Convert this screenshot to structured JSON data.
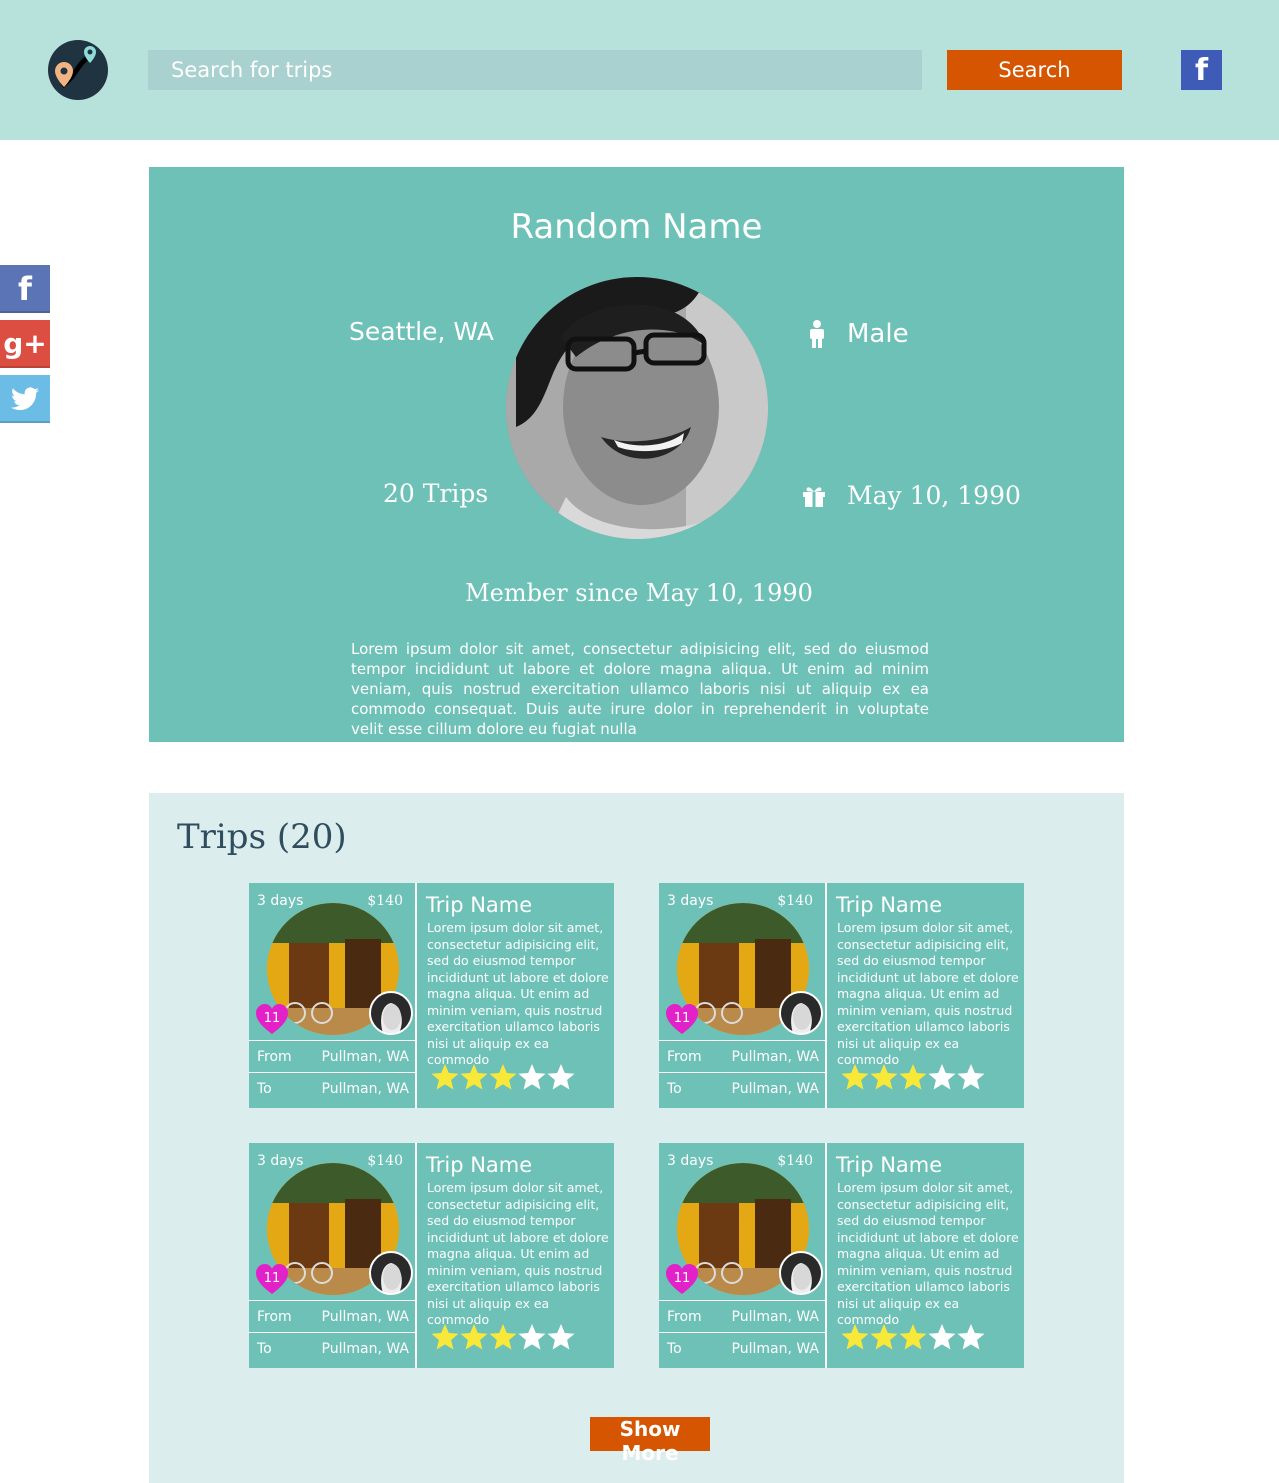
{
  "header": {
    "search_placeholder": "Search for trips",
    "search_label": "Search"
  },
  "share": [
    "facebook",
    "google-plus",
    "twitter"
  ],
  "profile": {
    "name": "Random Name",
    "location": "Seattle, WA",
    "trips": "20 Trips",
    "gender": "Male",
    "birthday": "May 10, 1990",
    "member_since": "Member since May 10, 1990",
    "bio": "Lorem ipsum dolor sit amet, consectetur adipisicing elit, sed do eiusmod tempor incididunt ut labore et dolore magna aliqua. Ut enim ad minim veniam, quis nostrud exercitation ullamco laboris nisi ut aliquip ex ea commodo consequat. Duis aute irure dolor in reprehenderit in voluptate velit esse cillum dolore eu fugiat nulla"
  },
  "trips_title": "Trips (20)",
  "trips": [
    {
      "days": "3 days",
      "price": "$140",
      "likes": "11",
      "from_label": "From",
      "from": "Pullman, WA",
      "to_label": "To",
      "to": "Pullman, WA",
      "name": "Trip Name",
      "desc": "Lorem ipsum dolor sit amet, consectetur adipisicing elit, sed do eiusmod tempor incididunt ut labore et dolore magna aliqua. Ut enim ad minim veniam, quis nostrud exercitation ullamco laboris nisi ut aliquip ex ea commodo",
      "rating": 3,
      "rating_max": 5
    },
    {
      "days": "3 days",
      "price": "$140",
      "likes": "11",
      "from_label": "From",
      "from": "Pullman, WA",
      "to_label": "To",
      "to": "Pullman, WA",
      "name": "Trip Name",
      "desc": "Lorem ipsum dolor sit amet, consectetur adipisicing elit, sed do eiusmod tempor incididunt ut labore et dolore magna aliqua. Ut enim ad minim veniam, quis nostrud exercitation ullamco laboris nisi ut aliquip ex ea commodo",
      "rating": 3,
      "rating_max": 5
    },
    {
      "days": "3 days",
      "price": "$140",
      "likes": "11",
      "from_label": "From",
      "from": "Pullman, WA",
      "to_label": "To",
      "to": "Pullman, WA",
      "name": "Trip Name",
      "desc": "Lorem ipsum dolor sit amet, consectetur adipisicing elit, sed do eiusmod tempor incididunt ut labore et dolore magna aliqua. Ut enim ad minim veniam, quis nostrud exercitation ullamco laboris nisi ut aliquip ex ea commodo",
      "rating": 3,
      "rating_max": 5
    },
    {
      "days": "3 days",
      "price": "$140",
      "likes": "11",
      "from_label": "From",
      "from": "Pullman, WA",
      "to_label": "To",
      "to": "Pullman, WA",
      "name": "Trip Name",
      "desc": "Lorem ipsum dolor sit amet, consectetur adipisicing elit, sed do eiusmod tempor incididunt ut labore et dolore magna aliqua. Ut enim ad minim veniam, quis nostrud exercitation ullamco laboris nisi ut aliquip ex ea commodo",
      "rating": 3,
      "rating_max": 5
    }
  ],
  "show_more_label": "Show More",
  "colors": {
    "header_bg": "#b7e2dc",
    "accent": "#6ec1b7",
    "button": "#d55500",
    "section_bg": "#dbeeed",
    "star_on": "#f7e83a",
    "star_off": "#ffffff",
    "heart": "#e321c9"
  }
}
